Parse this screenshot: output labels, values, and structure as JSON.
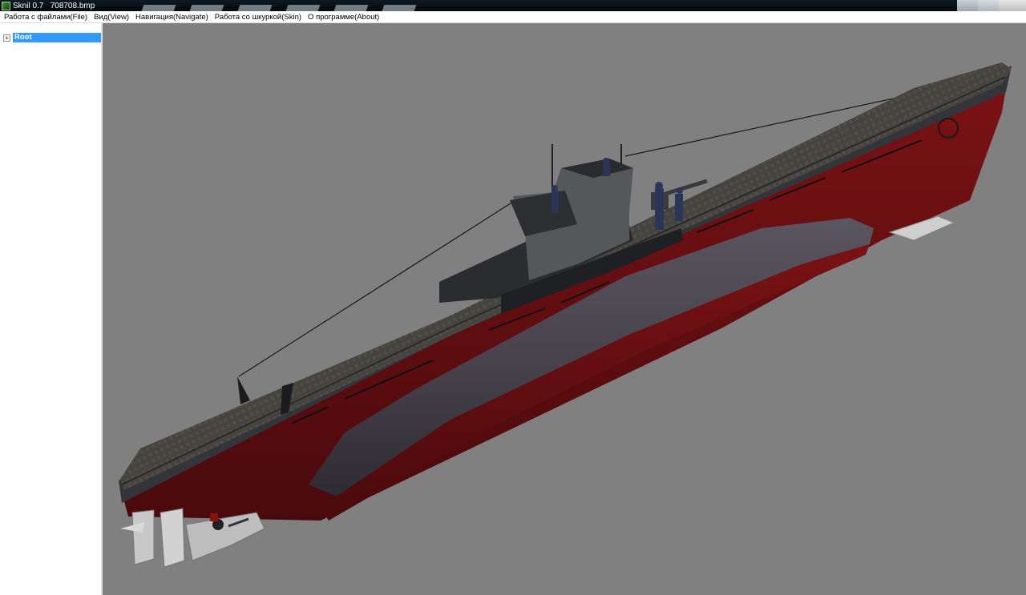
{
  "window": {
    "title": "Sknil 0.7   708708.bmp"
  },
  "menu": [
    {
      "label": "Работа с файлами(File)"
    },
    {
      "label": "Вид(View)"
    },
    {
      "label": "Навигация(Navigate)"
    },
    {
      "label": "Работа со шкуркой(Skin)"
    },
    {
      "label": "О программе(About)"
    }
  ],
  "tree": {
    "root": {
      "expander": "+",
      "label": "Root",
      "selected": true
    }
  },
  "viewport": {
    "background": "#808080",
    "model": "submarine",
    "colors": {
      "hull_red": "#6a0f12",
      "hull_dark": "#3a3b3e",
      "deck": "#4a4946",
      "saddle_tank": "#4b4650"
    }
  }
}
